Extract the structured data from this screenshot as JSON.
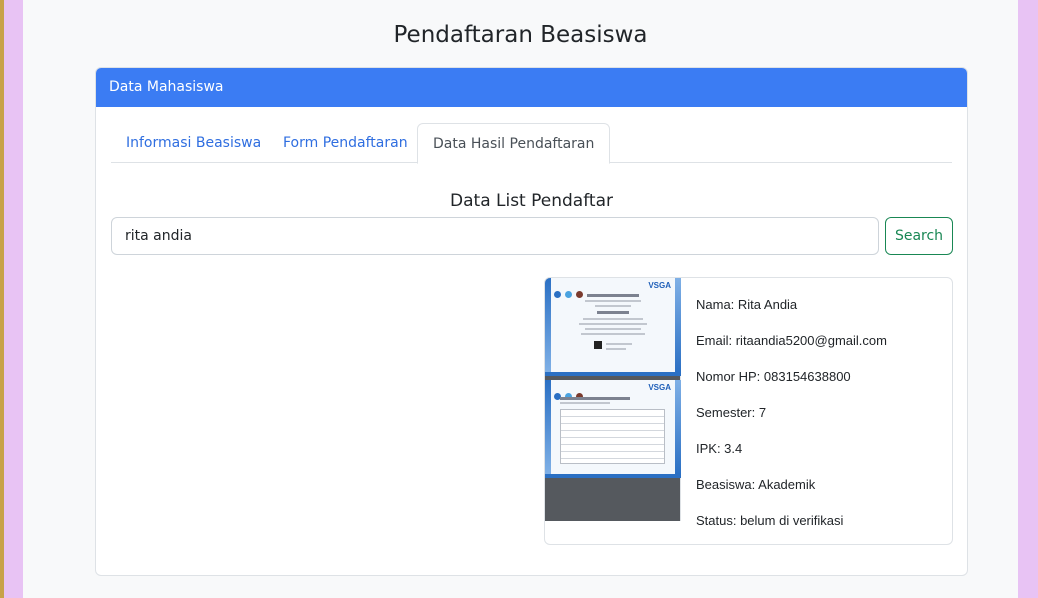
{
  "page": {
    "title": "Pendaftaran Beasiswa"
  },
  "card": {
    "header": "Data Mahasiswa"
  },
  "tabs": [
    {
      "label": "Informasi Beasiswa",
      "active": false
    },
    {
      "label": "Form Pendaftaran",
      "active": false
    },
    {
      "label": "Data Hasil Pendaftaran",
      "active": true
    }
  ],
  "list": {
    "title": "Data List Pendaftar"
  },
  "search": {
    "value": "rita andia",
    "button_label": "Search"
  },
  "result": {
    "image": {
      "brand": "VSGA",
      "icon": "certificate-image"
    },
    "nama": "Nama: Rita Andia",
    "email": "Email: ritaandia5200@gmail.com",
    "nomor_hp": "Nomor HP: 083154638800",
    "semester": "Semester: 7",
    "ipk": "IPK: 3.4",
    "beasiswa": "Beasiswa: Akademik",
    "status": "Status: belum di verifikasi"
  },
  "colors": {
    "background": "#e8c3f4",
    "header": "#3b7cf3",
    "link": "#2f6ee0",
    "success": "#198754"
  }
}
